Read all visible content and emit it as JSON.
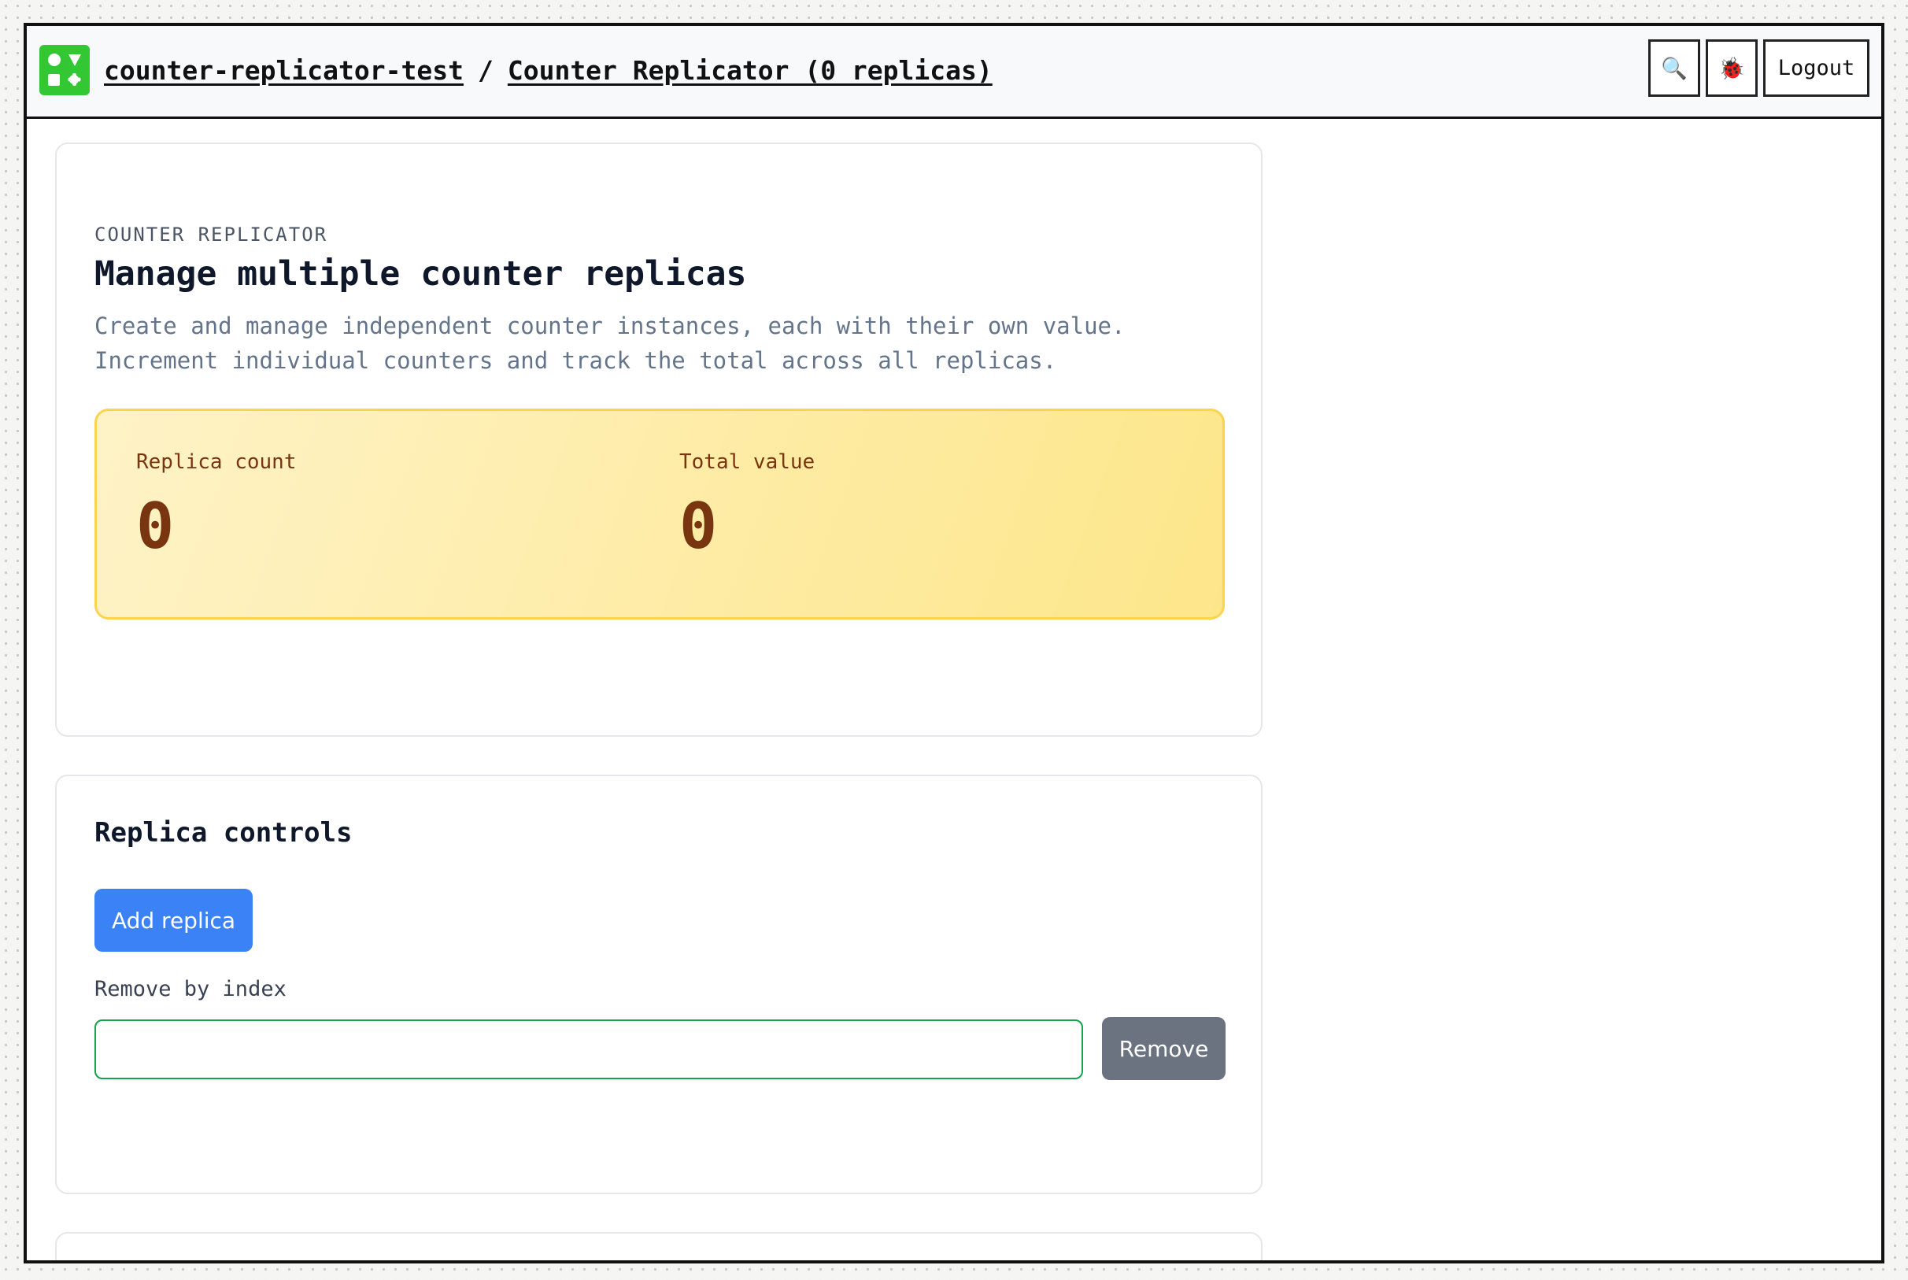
{
  "header": {
    "project": "counter-replicator-test",
    "separator": "/",
    "page": "Counter Replicator (0 replicas)",
    "search_icon": "🔍",
    "bug_icon": "🐞",
    "logout_label": "Logout"
  },
  "intro": {
    "eyebrow": "COUNTER REPLICATOR",
    "title": "Manage multiple counter replicas",
    "description": "Create and manage independent counter instances, each with their own value. Increment individual counters and track the total across all replicas."
  },
  "stats": {
    "replica_count_label": "Replica count",
    "replica_count": "0",
    "total_value_label": "Total value",
    "total_value": "0"
  },
  "controls": {
    "title": "Replica controls",
    "add_label": "Add replica",
    "remove_label": "Remove by index",
    "remove_value": "",
    "remove_button": "Remove"
  },
  "colors": {
    "accent": "#3b82f6",
    "logo": "#34c734",
    "stats_border": "#fcd34d",
    "stats_text": "#78350f"
  }
}
